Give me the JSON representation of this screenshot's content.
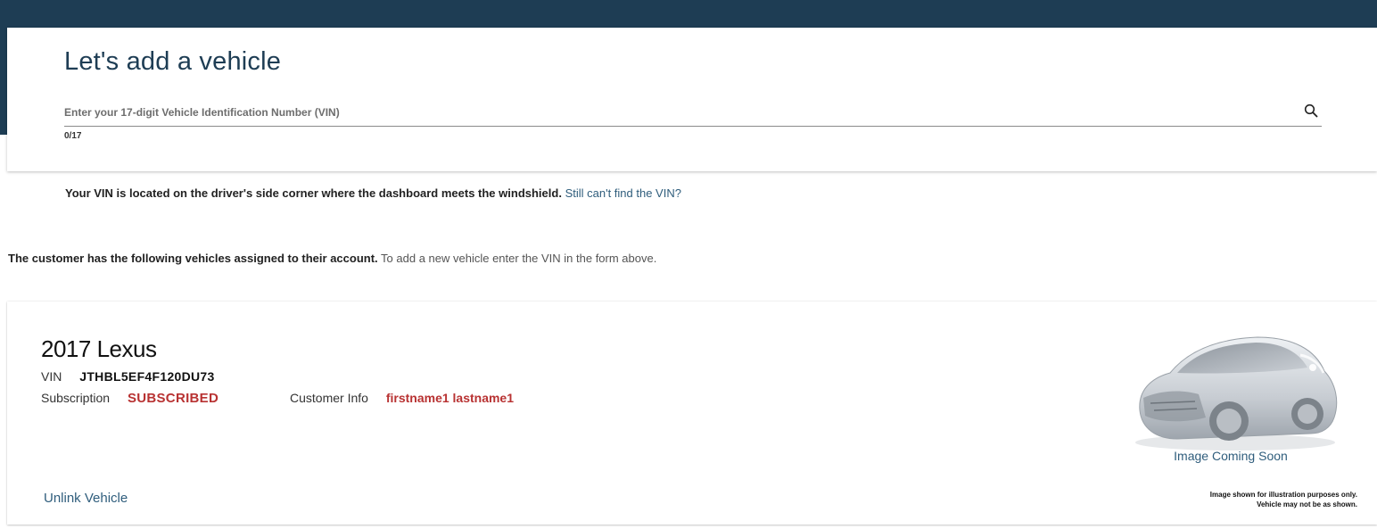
{
  "header": {
    "title": "Let's add a vehicle"
  },
  "vin_form": {
    "placeholder": "Enter your 17-digit Vehicle Identification Number (VIN)",
    "value": "",
    "counter": "0/17",
    "search_icon": "search-icon"
  },
  "vin_help": {
    "text": "Your VIN is located on the driver's side corner where the dashboard meets the windshield.",
    "link": "Still can't find the VIN?"
  },
  "vehicles_note": {
    "bold": "The customer has the following vehicles assigned to their account.",
    "rest": "To add a new vehicle enter the VIN in the form above."
  },
  "vehicle": {
    "title": "2017 Lexus",
    "vin_label": "VIN",
    "vin_value": "JTHBL5EF4F120DU73",
    "subscription_label": "Subscription",
    "subscription_value": "SUBSCRIBED",
    "customer_label": "Customer Info",
    "customer_value": "firstname1 lastname1",
    "unlink_label": "Unlink Vehicle",
    "image_caption": "Image Coming Soon",
    "disclaimer_line1": "Image shown for illustration purposes only.",
    "disclaimer_line2": "Vehicle may not be as shown."
  },
  "colors": {
    "header_band": "#1e3d54",
    "accent_red": "#b83232",
    "link_blue": "#2f5d7c"
  }
}
